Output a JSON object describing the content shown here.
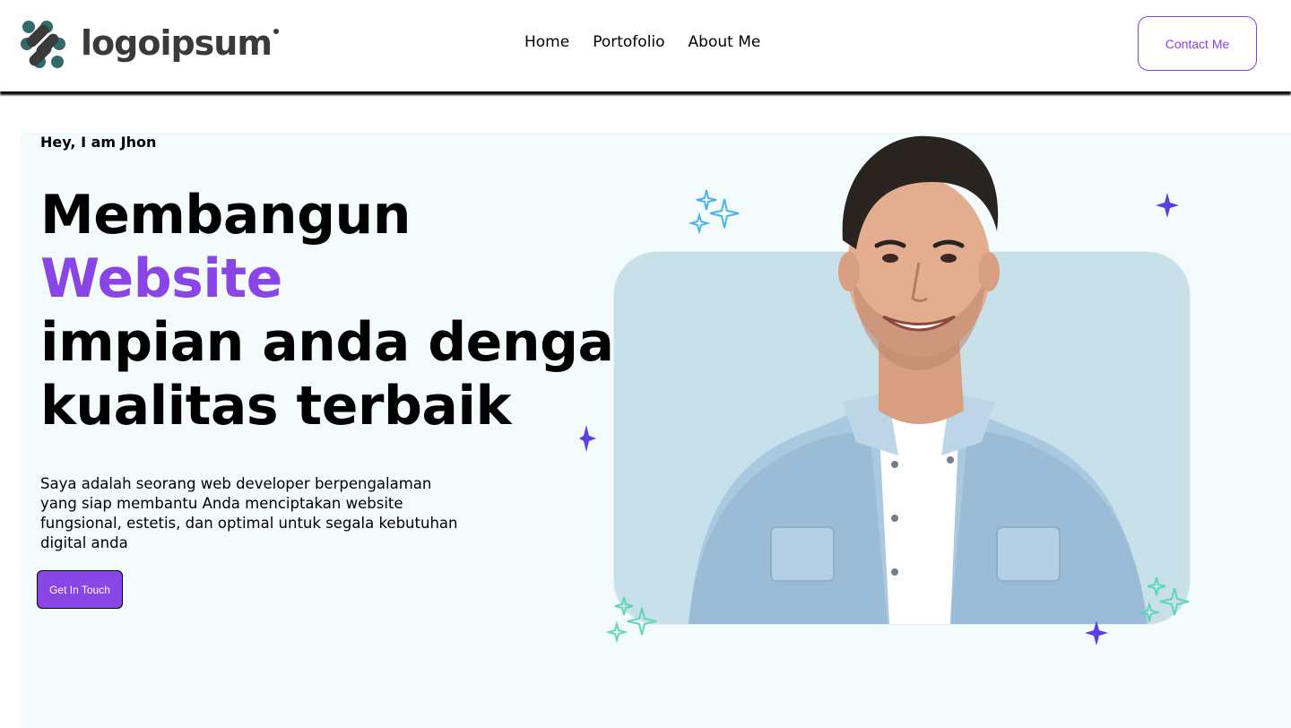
{
  "header": {
    "logo_text": "logoipsum",
    "nav": [
      {
        "label": "Home"
      },
      {
        "label": "Portofolio"
      },
      {
        "label": "About Me"
      }
    ],
    "contact_label": "Contact Me"
  },
  "hero": {
    "greeting": "Hey, I am Jhon",
    "headline_line1": "Membangun",
    "headline_accent": "Website",
    "headline_line3": "impian anda dengan",
    "headline_line4": "kualitas terbaik",
    "description": "Saya adalah seorang web developer berpengalaman yang siap membantu Anda menciptakan website fungsional, estetis, dan optimal untuk segala kebutuhan digital anda",
    "cta_label": "Get In Touch"
  },
  "colors": {
    "accent": "#8a45e6",
    "hero_background": "#f4fbfc",
    "card_background": "#c8e0ea",
    "sparkle_blue": "#4ab3e8",
    "sparkle_teal": "#5fd6b8",
    "sparkle_purple": "#5b3ee6"
  },
  "icons": [
    "logo-mark-icon",
    "sparkle-icon"
  ]
}
